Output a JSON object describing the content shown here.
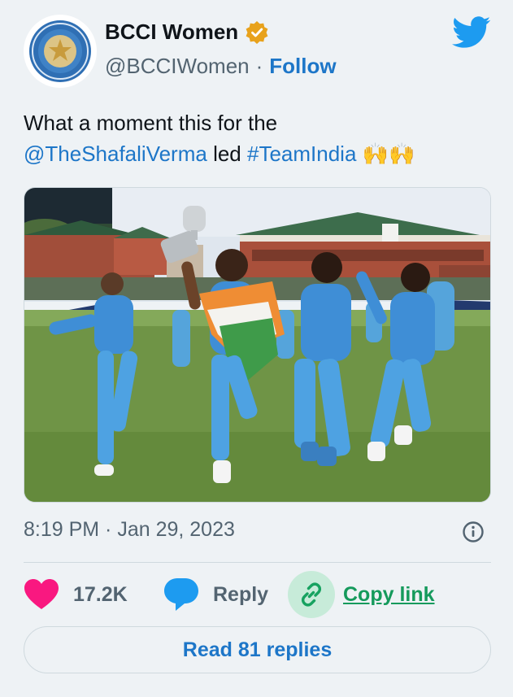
{
  "author": {
    "name": "BCCI Women",
    "handle": "@BCCIWomen",
    "separator": "·",
    "follow_label": "Follow",
    "verified_color": "#e8a21c"
  },
  "tweet": {
    "text_prefix": "What a moment this for the",
    "mention": "@TheShafaliVerma",
    "middle": " led ",
    "hashtag": "#TeamIndia",
    "emoji": " 🙌🙌"
  },
  "timestamp": "8:19 PM · Jan 29, 2023",
  "actions": {
    "like_count": "17.2K",
    "reply_label": "Reply",
    "copy_label": "Copy link"
  },
  "read_replies_label": "Read 81 replies",
  "colors": {
    "accent_blue": "#1d76c8",
    "like_pink": "#f91880",
    "reply_blue": "#1d9bf0",
    "copy_green": "#159a5c",
    "muted": "#536471"
  },
  "icons": [
    "bcci-logo-icon",
    "verified-badge-icon",
    "twitter-bird-icon",
    "info-icon",
    "heart-icon",
    "reply-bubble-icon",
    "link-icon"
  ]
}
